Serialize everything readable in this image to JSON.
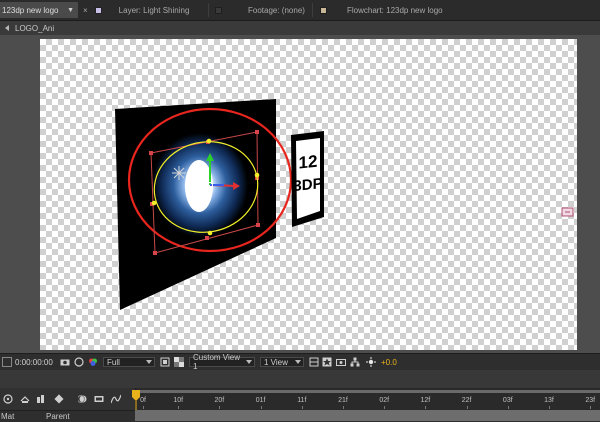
{
  "tabs": [
    {
      "label": "123dp new logo",
      "swatch": "#b7a0c8",
      "active": true
    },
    {
      "label": "Layer: Light Shining",
      "swatch": "#c8c0e8",
      "active": false
    },
    {
      "label": "Footage: (none)",
      "swatch": "#3a3a3a",
      "active": false
    },
    {
      "label": "Flowchart: 123dp new logo",
      "swatch": "#c8b898",
      "active": false
    }
  ],
  "breadcrumb": {
    "label": "LOGO_Ani"
  },
  "viewer": {
    "logo_text_line1": "12",
    "logo_text_line2": "3DP"
  },
  "viewer_toolbar": {
    "timecode": "0:00:00:00",
    "resolution": "Full",
    "view": "Custom View 1",
    "view_layout": "1 View",
    "exposure": "+0.0",
    "icons": [
      "snapshot-icon",
      "show-snapshot-icon",
      "color-channel-icon",
      "region-of-interest-icon",
      "transparency-grid-icon",
      "grid-icon",
      "3d-view-icon",
      "draft-3d-icon",
      "fast-preview-icon",
      "flowchart-icon",
      "exposure-icon"
    ]
  },
  "timeline": {
    "ticks": [
      "0f",
      "10f",
      "20f",
      "01f",
      "11f",
      "21f",
      "02f",
      "12f",
      "22f",
      "03f",
      "13f",
      "23f"
    ],
    "columns": {
      "mat": "Mat",
      "parent": "Parent"
    },
    "icons": [
      "search-icon",
      "comp-mini-flowchart-icon",
      "draft-3d-icon",
      "hide-shy-layers-icon",
      "frame-blending-icon",
      "motion-blur-icon",
      "brainstorm-icon",
      "graph-editor-icon"
    ],
    "cti_color": "#e8b21c"
  },
  "colors": {
    "selection_ellipse": "#e8261e",
    "mask_ellipse": "#f2ee2a",
    "handle": "#d9434a",
    "accent_exposure": "#e8b21c"
  }
}
